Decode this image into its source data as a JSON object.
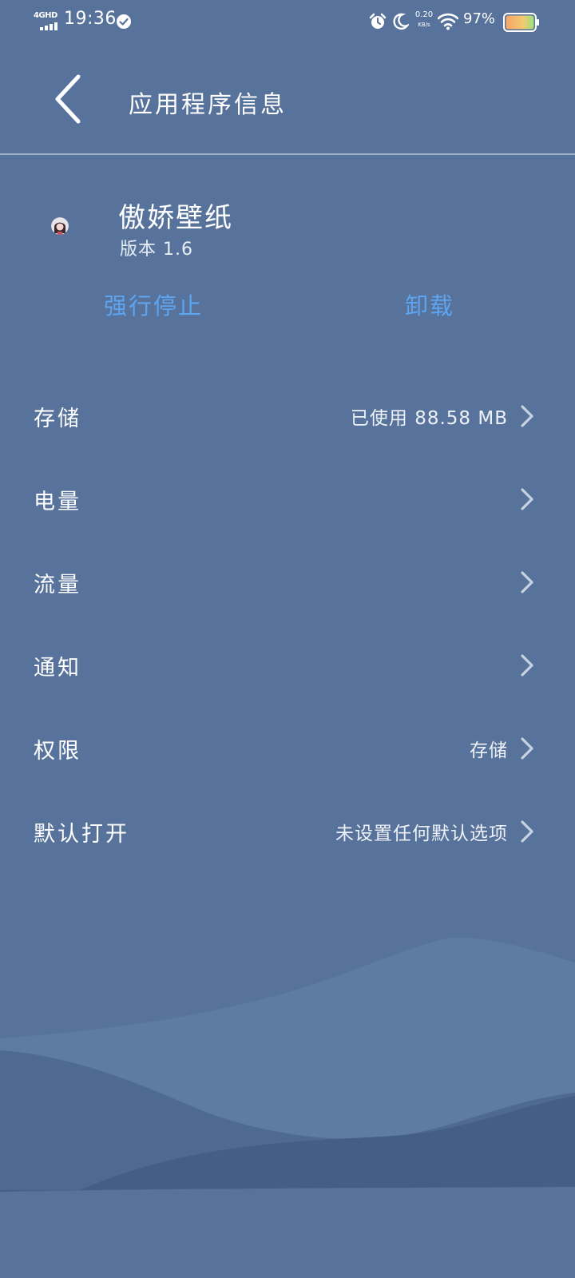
{
  "status_bar": {
    "network": "4GHD",
    "time": "19:36",
    "speed_value": "0.20",
    "speed_unit": "KB/s",
    "battery_percent": "97%",
    "icons": [
      "signal-icon",
      "check-circle-icon",
      "alarm-icon",
      "moon-icon",
      "wifi-icon",
      "battery-icon"
    ]
  },
  "header": {
    "title": "应用程序信息",
    "back_icon": "chevron-left-icon"
  },
  "app": {
    "name": "傲娇壁纸",
    "version": "版本 1.6"
  },
  "actions": {
    "force_stop": "强行停止",
    "uninstall": "卸载",
    "color": "#5ea4ef"
  },
  "settings": {
    "items": [
      {
        "label": "存储",
        "value": "已使用 88.58 MB"
      },
      {
        "label": "电量",
        "value": ""
      },
      {
        "label": "流量",
        "value": ""
      },
      {
        "label": "通知",
        "value": ""
      },
      {
        "label": "权限",
        "value": "存储"
      },
      {
        "label": "默认打开",
        "value": "未设置任何默认选项"
      }
    ]
  },
  "colors": {
    "background": "#58739b",
    "divider": "#9eb0c9",
    "accent": "#5ea4ef"
  }
}
